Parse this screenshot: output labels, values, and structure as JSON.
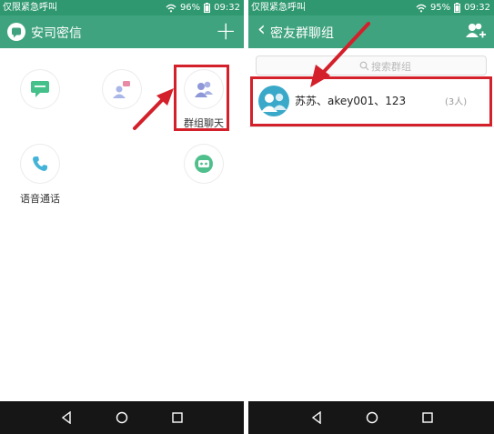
{
  "left": {
    "status": {
      "carrier": "仅限紧急呼叫",
      "battery": "96%",
      "time": "09:32"
    },
    "appbar": {
      "title": "安司密信",
      "add_symbol": "+"
    },
    "grid": {
      "group_chat_label": "群组聊天",
      "voice_call_label": "语音通话"
    }
  },
  "right": {
    "status": {
      "carrier": "仅限紧急呼叫",
      "battery": "95%",
      "time": "09:32"
    },
    "appbar": {
      "back_symbol": "‹",
      "title": "密友群聊组"
    },
    "search": {
      "placeholder": "搜索群组"
    },
    "groups": [
      {
        "name": "苏苏、akey001、123",
        "count": "(3人)"
      }
    ]
  },
  "colors": {
    "status_bar": "#2f9870",
    "app_bar": "#3fa37f",
    "highlight": "#d3202a",
    "nav_bar": "#161616"
  }
}
